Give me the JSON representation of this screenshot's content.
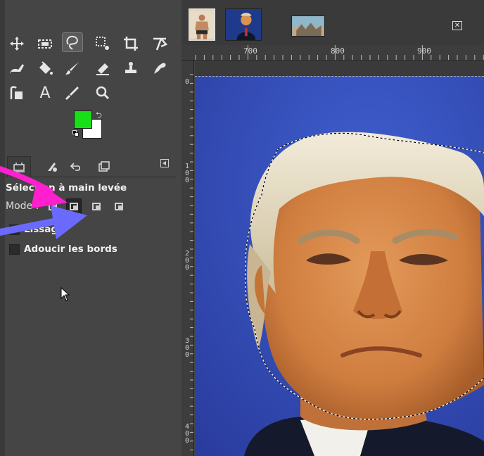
{
  "app": "GIMP",
  "toolbox": {
    "tools": [
      {
        "name": "move-tool-icon"
      },
      {
        "name": "rect-select-tool-icon"
      },
      {
        "name": "free-select-tool-icon",
        "active": true
      },
      {
        "name": "fuzzy-select-tool-icon"
      },
      {
        "name": "crop-tool-icon"
      },
      {
        "name": "transform-tool-icon"
      },
      {
        "name": "warp-tool-icon"
      },
      {
        "name": "bucket-fill-tool-icon"
      },
      {
        "name": "paintbrush-tool-icon"
      },
      {
        "name": "eraser-tool-icon"
      },
      {
        "name": "clone-tool-icon"
      },
      {
        "name": "smudge-tool-icon"
      },
      {
        "name": "paths-tool-icon"
      },
      {
        "name": "text-tool-icon"
      },
      {
        "name": "color-picker-tool-icon"
      },
      {
        "name": "zoom-tool-icon"
      }
    ],
    "text_tool_glyph": "A",
    "fg_color": "#17e017",
    "bg_color": "#ffffff"
  },
  "tool_options": {
    "tabs": [
      "tool-options",
      "device-status",
      "undo-history",
      "images"
    ],
    "title": "Sélection à main levée",
    "mode_label": "Mode :",
    "checks": [
      {
        "label": "Lissage",
        "checked": true
      },
      {
        "label": "Adoucir les bords",
        "checked": false
      }
    ]
  },
  "image_tabs": [
    {
      "name": "thumb-wrestler"
    },
    {
      "name": "thumb-trump",
      "active": true
    },
    {
      "name": "thumb-landscape"
    }
  ],
  "ruler": {
    "h_labels": [
      "700",
      "800",
      "900"
    ],
    "v_labels": [
      "0",
      "100",
      "200",
      "300",
      "400"
    ]
  },
  "annotations": {
    "arrow1_color": "#ff1fcf",
    "arrow2_color": "#6a6aff"
  }
}
